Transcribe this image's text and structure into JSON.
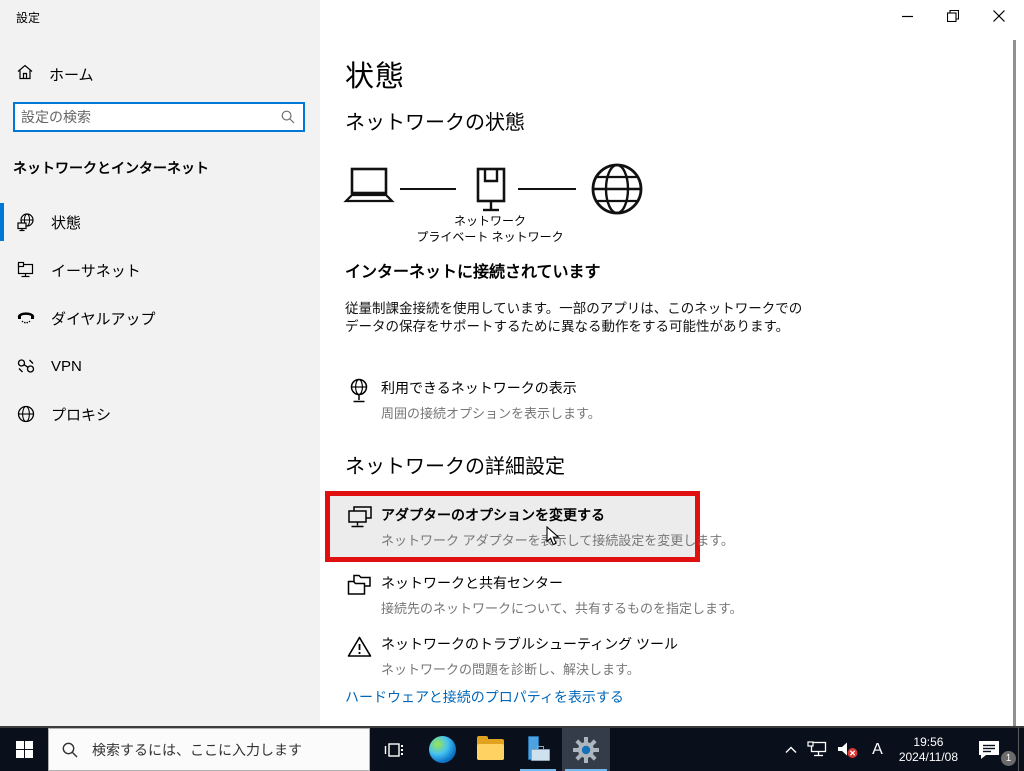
{
  "window": {
    "title": "設定"
  },
  "sidebar": {
    "home_label": "ホーム",
    "search_placeholder": "設定の検索",
    "section_label": "ネットワークとインターネット",
    "items": [
      {
        "label": "状態"
      },
      {
        "label": "イーサネット"
      },
      {
        "label": "ダイヤルアップ"
      },
      {
        "label": "VPN"
      },
      {
        "label": "プロキシ"
      }
    ]
  },
  "main": {
    "title": "状態",
    "network_status_heading": "ネットワークの状態",
    "diagram": {
      "network_label": "ネットワーク",
      "private_label": "プライベート ネットワーク"
    },
    "connection_heading": "インターネットに接続されています",
    "connection_desc": "従量制課金接続を使用しています。一部のアプリは、このネットワークでのデータの保存をサポートするために異なる動作をする可能性があります。",
    "available_networks": {
      "title": "利用できるネットワークの表示",
      "desc": "周囲の接続オプションを表示します。"
    },
    "advanced_heading": "ネットワークの詳細設定",
    "adapter_options": {
      "title": "アダプターのオプションを変更する",
      "desc": "ネットワーク アダプターを表示して接続設定を変更します。"
    },
    "sharing_center": {
      "title": "ネットワークと共有センター",
      "desc": "接続先のネットワークについて、共有するものを指定します。"
    },
    "troubleshooter": {
      "title": "ネットワークのトラブルシューティング ツール",
      "desc": "ネットワークの問題を診断し、解決します。"
    },
    "hardware_link": "ハードウェアと接続のプロパティを表示する"
  },
  "taskbar": {
    "search_placeholder": "検索するには、ここに入力します",
    "tray": {
      "ime": "A",
      "time": "19:56",
      "date": "2024/11/08",
      "notification_count": "1"
    }
  },
  "colors": {
    "accent": "#0078d7",
    "annotation_red": "#e01010",
    "link_blue": "#0067b8",
    "sidebar_bg": "#f2f2f2",
    "taskbar_bg": "#0a0f1c"
  }
}
